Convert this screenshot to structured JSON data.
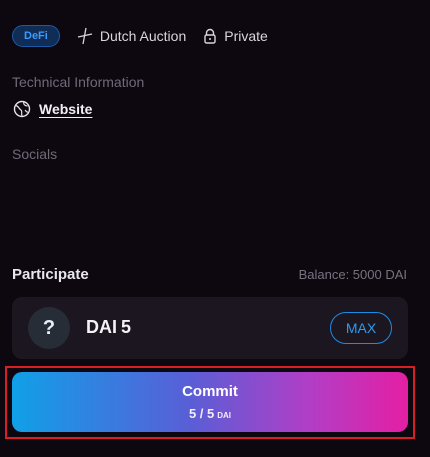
{
  "tags": {
    "category": "DeFi",
    "auction_type": "Dutch Auction",
    "visibility": "Private"
  },
  "technical": {
    "heading": "Technical Information",
    "website_label": "Website"
  },
  "socials": {
    "heading": "Socials"
  },
  "participate": {
    "title": "Participate",
    "balance": "Balance: 5000 DAI",
    "token_symbol": "DAI",
    "token_amount": "5",
    "token_icon_glyph": "?",
    "max_label": "MAX"
  },
  "commit": {
    "label": "Commit",
    "progress_text": "5 / 5",
    "progress_unit": "DAI",
    "progress_fraction": 1.0
  },
  "colors": {
    "accent_blue": "#1c8ce6",
    "gradient_start": "#10a0e8",
    "gradient_end": "#e41fa4",
    "highlight_outline": "#d91f26",
    "background": "#0d0810"
  }
}
